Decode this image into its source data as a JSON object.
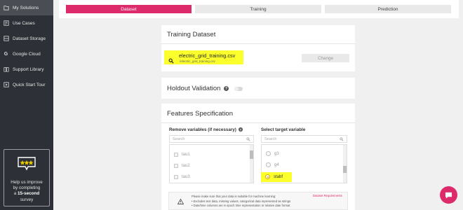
{
  "sidebar": {
    "items": [
      {
        "label": "My Solutions",
        "icon": "folder-icon",
        "active": true
      },
      {
        "label": "Use Cases",
        "icon": "cases-icon"
      },
      {
        "label": "Dataset Storage",
        "icon": "storage-icon"
      },
      {
        "label": "Google Cloud",
        "icon": "google-icon"
      },
      {
        "label": "Support Library",
        "icon": "book-icon"
      },
      {
        "label": "Quick Start Tour",
        "icon": "tour-icon"
      }
    ],
    "promo": {
      "line1": "Help us improve",
      "line2": "by completing",
      "line3_prefix": "a ",
      "line3_bold": "15-second",
      "line4": "survey"
    }
  },
  "steps": [
    {
      "label": "Dataset",
      "active": true
    },
    {
      "label": "Training"
    },
    {
      "label": "Prediction"
    }
  ],
  "training_dataset": {
    "title": "Training Dataset",
    "file_name": "electric_grid_training.csv",
    "file_sub": "/electric_grid_training.csv",
    "change_label": "Change"
  },
  "holdout": {
    "title": "Holdout Validation",
    "enabled": false
  },
  "features": {
    "title": "Features Specification",
    "remove_label": "Remove variables (if necessary)",
    "target_label": "Select target variable",
    "search_placeholder": "Search",
    "remove_items": [
      "tau1",
      "tau2",
      "tau3"
    ],
    "target_items": [
      {
        "label": "g3",
        "selected": false
      },
      {
        "label": "g4",
        "selected": false
      },
      {
        "label": "stabf",
        "selected": true
      }
    ],
    "notice": {
      "line1": "Please make sure that your data is suitable for machine learning:",
      "line2": "• Excludes text data, missing values, categorical data represented as strings",
      "line3": "• Date/time columns are in epoch time representation or relative date format",
      "link": "Dataset Requirements"
    }
  },
  "colors": {
    "accent": "#dd2a6b",
    "highlight": "#fbff2b",
    "sidebar_bg": "#2d3036"
  }
}
